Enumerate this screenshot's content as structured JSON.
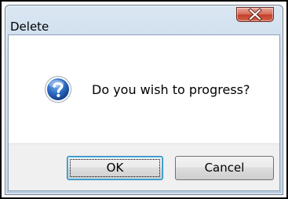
{
  "window": {
    "title": "Delete",
    "close_icon": "close-x-icon"
  },
  "dialog": {
    "icon": "question-icon",
    "icon_color": "#2f6ec4",
    "message": "Do you wish to progress?"
  },
  "buttons": {
    "ok_label": "OK",
    "cancel_label": "Cancel"
  },
  "colors": {
    "close_button": "#c9452f",
    "title_bar": "#c9daeb",
    "button_area": "#f0f0f0"
  }
}
